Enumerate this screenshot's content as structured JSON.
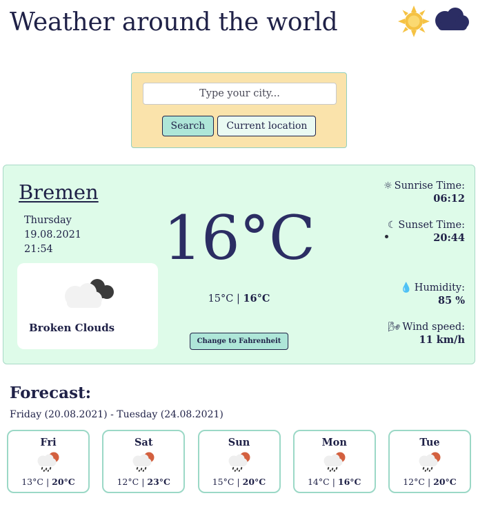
{
  "header": {
    "title": "Weather around the world",
    "icons": [
      "sun-icon",
      "cloud-icon"
    ]
  },
  "search": {
    "placeholder": "Type your city...",
    "value": "",
    "search_label": "Search",
    "location_label": "Current location"
  },
  "current": {
    "city": "Bremen",
    "weekday": "Thursday",
    "date": "19.08.2021",
    "time": "21:54",
    "condition": "Broken Clouds",
    "temperature": "16°C",
    "temp_min": "15°C",
    "separator": "|",
    "temp_max": "16°C",
    "unit_button": "Change to Fahrenheit",
    "details": {
      "sunrise_label": "Sunrise Time:",
      "sunrise_value": "06:12",
      "sunset_label": "Sunset Time:",
      "sunset_value": "20:44",
      "humidity_label": "Humidity:",
      "humidity_value": "85 %",
      "wind_label": "Wind speed:",
      "wind_value": "11 km/h"
    }
  },
  "forecast": {
    "heading": "Forecast:",
    "range": "Friday (20.08.2021) - Tuesday (24.08.2021)",
    "days": [
      {
        "day": "Fri",
        "min": "13°C",
        "sep": "|",
        "max": "20°C",
        "icon": "sun-behind-rain-cloud-icon"
      },
      {
        "day": "Sat",
        "min": "12°C",
        "sep": "|",
        "max": "23°C",
        "icon": "sun-behind-rain-cloud-icon"
      },
      {
        "day": "Sun",
        "min": "15°C",
        "sep": "|",
        "max": "20°C",
        "icon": "sun-behind-rain-cloud-icon"
      },
      {
        "day": "Mon",
        "min": "14°C",
        "sep": "|",
        "max": "16°C",
        "icon": "sun-behind-rain-cloud-icon"
      },
      {
        "day": "Tue",
        "min": "12°C",
        "sep": "|",
        "max": "20°C",
        "icon": "sun-behind-rain-cloud-icon"
      }
    ]
  },
  "colors": {
    "navy": "#1f2147",
    "mint_card": "#defbe9",
    "teal_button": "#aee6d8",
    "search_panel": "#fae3ab",
    "sun_yellow": "#f5c243",
    "sun_orange": "#d3603f",
    "border_teal": "#9bd8c6"
  }
}
